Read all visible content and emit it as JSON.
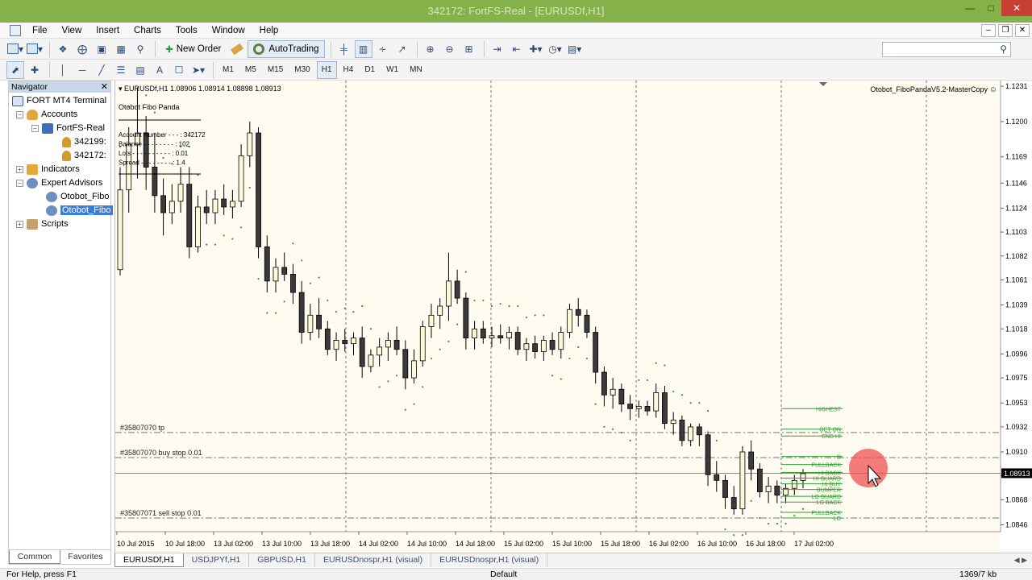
{
  "window": {
    "title": "342172: FortFS-Real - [EURUSDf,H1]",
    "controls": [
      "minimize-icon",
      "maximize-icon",
      "close-icon"
    ]
  },
  "menu": {
    "items": [
      "File",
      "View",
      "Insert",
      "Charts",
      "Tools",
      "Window",
      "Help"
    ]
  },
  "toolbar": {
    "new_order_label": "New Order",
    "autotrading_label": "AutoTrading",
    "timeframes": [
      "M1",
      "M5",
      "M15",
      "M30",
      "H1",
      "H4",
      "D1",
      "W1",
      "MN"
    ],
    "active_timeframe": "H1"
  },
  "navigator": {
    "title": "Navigator",
    "tree": [
      {
        "label": "FORT MT4 Terminal",
        "icon": "monitor-icon"
      },
      {
        "label": "Accounts",
        "icon": "accounts-icon"
      },
      {
        "label": "FortFS-Real",
        "icon": "server-icon"
      },
      {
        "label": "342199:",
        "icon": "person-icon"
      },
      {
        "label": "342172:",
        "icon": "person-icon"
      },
      {
        "label": "Indicators",
        "icon": "indicators-icon"
      },
      {
        "label": "Expert Advisors",
        "icon": "expert-advisors-icon"
      },
      {
        "label": "Otobot_Fibo",
        "icon": "ea-icon"
      },
      {
        "label": "Otobot_Fibo",
        "icon": "ea-icon",
        "selected": true
      },
      {
        "label": "Scripts",
        "icon": "scripts-icon"
      }
    ],
    "tabs": [
      "Common",
      "Favorites"
    ],
    "active_tab": "Common"
  },
  "chart": {
    "header": "EURUSDf,H1  1.08906 1.08914 1.08898 1.08913",
    "ea_name": "Otobot_FiboPandaV5.2-MasterCopy",
    "panel": {
      "title": "Otobot Fibo Panda",
      "rows": [
        "Account Number - - - : 342172",
        "Balance - - - - - - - - : 102",
        "Lots - - - - - - - - - - : 0.01",
        "Spread - - - - - - - - : 1.4"
      ]
    },
    "order_lines": [
      {
        "label": "#35807070 tp",
        "price": 1.0927
      },
      {
        "label": "#35807070 buy stop 0.01",
        "price": 1.0905
      },
      {
        "label": "#35807071 sell stop 0.01",
        "price": 1.0852
      }
    ],
    "fibo_labels": [
      "HIGHEST",
      "GET ON",
      "END HI",
      "O",
      "PULLBACK",
      "HI BACK",
      "HI GUARD",
      "HI BUY",
      "BUMPER",
      "LO GUARD",
      "LO BACK",
      "PULLBACK",
      "LO"
    ],
    "current_price": "1.08913",
    "time_labels": [
      "10 Jul 2015",
      "10 Jul 18:00",
      "13 Jul 02:00",
      "13 Jul 10:00",
      "13 Jul 18:00",
      "14 Jul 02:00",
      "14 Jul 10:00",
      "14 Jul 18:00",
      "15 Jul 02:00",
      "15 Jul 10:00",
      "15 Jul 18:00",
      "16 Jul 02:00",
      "16 Jul 10:00",
      "16 Jul 18:00",
      "17 Jul 02:00"
    ]
  },
  "chart_data": {
    "type": "candlestick",
    "symbol": "EURUSDf",
    "timeframe": "H1",
    "y_ticks": [
      1.1231,
      1.12,
      1.1169,
      1.1146,
      1.1124,
      1.1103,
      1.1082,
      1.1061,
      1.1039,
      1.1018,
      1.0996,
      1.0975,
      1.0953,
      1.0932,
      1.091,
      1.0889,
      1.0868,
      1.0846
    ],
    "ylim": [
      1.084,
      1.1236
    ],
    "ohlc": [
      [
        1.107,
        1.116,
        1.1065,
        1.114
      ],
      [
        1.114,
        1.1195,
        1.112,
        1.118
      ],
      [
        1.118,
        1.123,
        1.115,
        1.119
      ],
      [
        1.119,
        1.1205,
        1.114,
        1.116
      ],
      [
        1.116,
        1.119,
        1.112,
        1.1135
      ],
      [
        1.1135,
        1.115,
        1.11,
        1.112
      ],
      [
        1.112,
        1.1145,
        1.111,
        1.113
      ],
      [
        1.113,
        1.116,
        1.112,
        1.1145
      ],
      [
        1.1145,
        1.116,
        1.108,
        1.109
      ],
      [
        1.109,
        1.1135,
        1.1085,
        1.1125
      ],
      [
        1.1125,
        1.114,
        1.111,
        1.112
      ],
      [
        1.112,
        1.114,
        1.111,
        1.1132
      ],
      [
        1.1132,
        1.1145,
        1.1118,
        1.1125
      ],
      [
        1.1125,
        1.114,
        1.1115,
        1.113
      ],
      [
        1.113,
        1.118,
        1.1125,
        1.117
      ],
      [
        1.117,
        1.12,
        1.116,
        1.119
      ],
      [
        1.119,
        1.1195,
        1.108,
        1.109
      ],
      [
        1.109,
        1.11,
        1.105,
        1.106
      ],
      [
        1.106,
        1.108,
        1.105,
        1.1072
      ],
      [
        1.1072,
        1.1085,
        1.106,
        1.1066
      ],
      [
        1.1066,
        1.1075,
        1.104,
        1.105
      ],
      [
        1.105,
        1.106,
        1.1005,
        1.1015
      ],
      [
        1.1015,
        1.104,
        1.1008,
        1.103
      ],
      [
        1.103,
        1.1045,
        1.101,
        1.1018
      ],
      [
        1.1018,
        1.1025,
        1.0995,
        1.1
      ],
      [
        1.1,
        1.1015,
        1.099,
        1.1008
      ],
      [
        1.1008,
        1.1018,
        1.0998,
        1.1005
      ],
      [
        1.1005,
        1.1015,
        1.0995,
        1.101
      ],
      [
        1.101,
        1.102,
        1.0975,
        1.0985
      ],
      [
        1.0985,
        1.1,
        1.098,
        1.0995
      ],
      [
        1.0995,
        1.101,
        1.0985,
        1.1002
      ],
      [
        1.1002,
        1.1015,
        1.099,
        1.1008
      ],
      [
        1.1008,
        1.102,
        1.0995,
        1.1
      ],
      [
        1.1,
        1.1008,
        1.0965,
        1.0975
      ],
      [
        1.0975,
        1.1,
        1.097,
        1.099
      ],
      [
        1.099,
        1.1025,
        1.0985,
        1.102
      ],
      [
        1.102,
        1.104,
        1.101,
        1.103
      ],
      [
        1.103,
        1.1045,
        1.1018,
        1.1038
      ],
      [
        1.1038,
        1.1085,
        1.1025,
        1.106
      ],
      [
        1.106,
        1.107,
        1.104,
        1.1045
      ],
      [
        1.1045,
        1.105,
        1.1,
        1.101
      ],
      [
        1.101,
        1.1025,
        1.1,
        1.1018
      ],
      [
        1.1018,
        1.1025,
        1.1005,
        1.101
      ],
      [
        1.101,
        1.102,
        1.1002,
        1.1012
      ],
      [
        1.1012,
        1.1022,
        1.1005,
        1.101
      ],
      [
        1.101,
        1.102,
        1.1,
        1.1015
      ],
      [
        1.1015,
        1.102,
        1.0995,
        1.1
      ],
      [
        1.1,
        1.101,
        1.099,
        1.1005
      ],
      [
        1.1005,
        1.1012,
        1.0992,
        1.0998
      ],
      [
        1.0998,
        1.1012,
        1.099,
        1.1008
      ],
      [
        1.1008,
        1.1015,
        1.0995,
        1.1
      ],
      [
        1.1,
        1.102,
        1.0992,
        1.1015
      ],
      [
        1.1015,
        1.104,
        1.101,
        1.1035
      ],
      [
        1.1035,
        1.1045,
        1.102,
        1.103
      ],
      [
        1.103,
        1.1035,
        1.101,
        1.1015
      ],
      [
        1.1015,
        1.102,
        1.097,
        1.098
      ],
      [
        1.098,
        1.0985,
        1.095,
        1.096
      ],
      [
        1.096,
        1.0975,
        1.0948,
        1.0965
      ],
      [
        1.0965,
        1.097,
        1.0945,
        1.0952
      ],
      [
        1.0952,
        1.096,
        1.0938,
        1.0948
      ],
      [
        1.0948,
        1.0955,
        1.094,
        1.095
      ],
      [
        1.095,
        1.0955,
        1.0942,
        1.0946
      ],
      [
        1.0946,
        1.097,
        1.094,
        1.0962
      ],
      [
        1.0962,
        1.0968,
        1.093,
        1.0935
      ],
      [
        1.0935,
        1.0945,
        1.0925,
        1.0938
      ],
      [
        1.0938,
        1.0942,
        1.0915,
        1.092
      ],
      [
        1.092,
        1.0935,
        1.0915,
        1.0932
      ],
      [
        1.0932,
        1.0935,
        1.0915,
        1.0925
      ],
      [
        1.0925,
        1.0928,
        1.088,
        1.089
      ],
      [
        1.089,
        1.0902,
        1.0875,
        1.0885
      ],
      [
        1.0885,
        1.089,
        1.086,
        1.087
      ],
      [
        1.087,
        1.088,
        1.0855,
        1.086
      ],
      [
        1.086,
        1.0915,
        1.0855,
        1.091
      ],
      [
        1.091,
        1.092,
        1.0885,
        1.0895
      ],
      [
        1.0895,
        1.09,
        1.087,
        1.0875
      ],
      [
        1.0875,
        1.0888,
        1.0865,
        1.088
      ],
      [
        1.088,
        1.0885,
        1.0865,
        1.0872
      ],
      [
        1.0872,
        1.0882,
        1.0865,
        1.0878
      ],
      [
        1.0878,
        1.089,
        1.0872,
        1.0885
      ],
      [
        1.0885,
        1.0895,
        1.0878,
        1.0891
      ]
    ],
    "parabolic_sar_dots": true,
    "grid": false
  },
  "tabs": {
    "items": [
      "EURUSDf,H1",
      "USDJPYf,H1",
      "GBPUSD,H1",
      "EURUSDnospr,H1 (visual)",
      "EURUSDnospr,H1 (visual)"
    ],
    "active": 0
  },
  "status": {
    "help": "For Help, press F1",
    "profile": "Default",
    "traffic": "1369/7 kb"
  },
  "colors": {
    "titlebar": "#86b04a",
    "chart_bg": "#fffbf0",
    "bull_candle": "#fdf8d8",
    "bear_candle": "#3a3a3a",
    "sar_dots": "#2e9b2e",
    "fibo_green": "#2ea02e",
    "order_line": "#666666",
    "price_label_bg": "#000000",
    "mouse_highlight": "#f25050"
  }
}
